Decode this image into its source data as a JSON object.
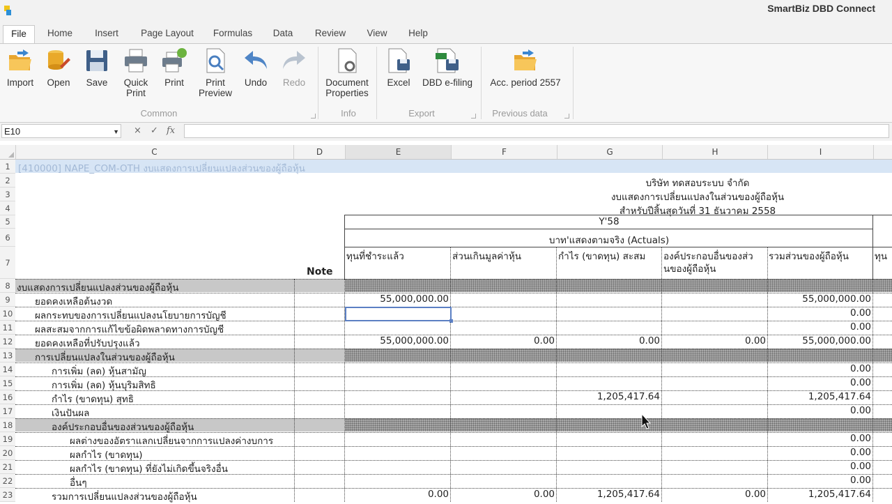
{
  "app": {
    "title": "SmartBiz DBD Connect"
  },
  "menu": {
    "tabs": [
      "File",
      "Home",
      "Insert",
      "Page Layout",
      "Formulas",
      "Data",
      "Review",
      "View",
      "Help"
    ],
    "active": "File"
  },
  "ribbon": {
    "buttons": {
      "import": "Import",
      "open": "Open",
      "save": "Save",
      "quick_print_1": "Quick",
      "quick_print_2": "Print",
      "print": "Print",
      "print_preview_1": "Print",
      "print_preview_2": "Preview",
      "undo": "Undo",
      "redo": "Redo",
      "doc_props_1": "Document",
      "doc_props_2": "Properties",
      "excel": "Excel",
      "dbd_efiling": "DBD e-filing",
      "acc_period": "Acc. period 2557"
    },
    "groups": {
      "common": "Common",
      "info": "Info",
      "export": "Export",
      "previous": "Previous data"
    }
  },
  "formula_bar": {
    "cell_ref": "E10",
    "cancel": "×",
    "enter": "✓",
    "fx": "fx",
    "value": ""
  },
  "sheet": {
    "columns": [
      "C",
      "D",
      "E",
      "F",
      "G",
      "H",
      "I"
    ],
    "row_numbers": [
      "1",
      "2",
      "3",
      "4",
      "5",
      "6",
      "7",
      "8",
      "9",
      "10",
      "11",
      "12",
      "13",
      "14",
      "15",
      "16",
      "17",
      "18",
      "19",
      "20",
      "21",
      "22",
      "23"
    ],
    "r1": "[410000] NAPE_COM-OTH งบแสดงการเปลี่ยนแปลงส่วนของผู้ถือหุ้น",
    "company": "บริษัท ทดสอบระบบ จำกัด",
    "statement": "งบแสดงการเปลี่ยนแปลงในส่วนของผู้ถือหุ้น",
    "period": "สำหรับปีสิ้นสุดวันที่  31 ธันวาคม 2558",
    "year": "Y'58",
    "basis": "บาท'แสดงตามจริง (Actuals)",
    "note": "Note",
    "col_heads": {
      "E": "ทุนที่ชำระแล้ว",
      "F": "ส่วนเกินมูลค่าหุ้น",
      "G": "กำไร (ขาดทุน) สะสม",
      "H1": "องค์ประกอบอื่นของส่ว",
      "H2": "นของผู้ถือหุ้น",
      "I": "รวมส่วนของผู้ถือหุ้น",
      "J": "ทุน"
    },
    "labels": {
      "r8": "งบแสดงการเปลี่ยนแปลงส่วนของผู้ถือหุ้น",
      "r9": "ยอดคงเหลือต้นงวด",
      "r10": "ผลกระทบของการเปลี่ยนแปลงนโยบายการบัญชี",
      "r11": "ผลสะสมจากการแก้ไขข้อผิดพลาดทางการบัญชี",
      "r12": "ยอดคงเหลือที่ปรับปรุงแล้ว",
      "r13": "การเปลี่ยนแปลงในส่วนของผู้ถือหุ้น",
      "r14": "การเพิ่ม (ลด) หุ้นสามัญ",
      "r15": "การเพิ่ม (ลด) หุ้นบุริมสิทธิ",
      "r16": "กำไร (ขาดทุน) สุทธิ",
      "r17": "เงินปันผล",
      "r18": "องค์ประกอบอื่นของส่วนของผู้ถือหุ้น",
      "r19": "ผลต่างของอัตราแลกเปลี่ยนจากการแปลงค่างบการ",
      "r20": "ผลกำไร (ขาดทุน)",
      "r21": "ผลกำไร (ขาดทุน) ที่ยังไม่เกิดขึ้นจริงอื่น",
      "r22": "อื่นๆ",
      "r23": "รวมการเปลี่ยนแปลงส่วนของผู้ถือหุ้น"
    },
    "values": {
      "r9_E": "55,000,000.00",
      "r9_I": "55,000,000.00",
      "r10_I": "0.00",
      "r11_I": "0.00",
      "r12_E": "55,000,000.00",
      "r12_F": "0.00",
      "r12_G": "0.00",
      "r12_H": "0.00",
      "r12_I": "55,000,000.00",
      "r14_I": "0.00",
      "r15_I": "0.00",
      "r16_G": "1,205,417.64",
      "r16_I": "1,205,417.64",
      "r17_I": "0.00",
      "r19_I": "0.00",
      "r20_I": "0.00",
      "r21_I": "0.00",
      "r22_I": "0.00",
      "r23_E": "0.00",
      "r23_F": "0.00",
      "r23_G": "1,205,417.64",
      "r23_H": "0.00",
      "r23_I": "1,205,417.64"
    }
  }
}
